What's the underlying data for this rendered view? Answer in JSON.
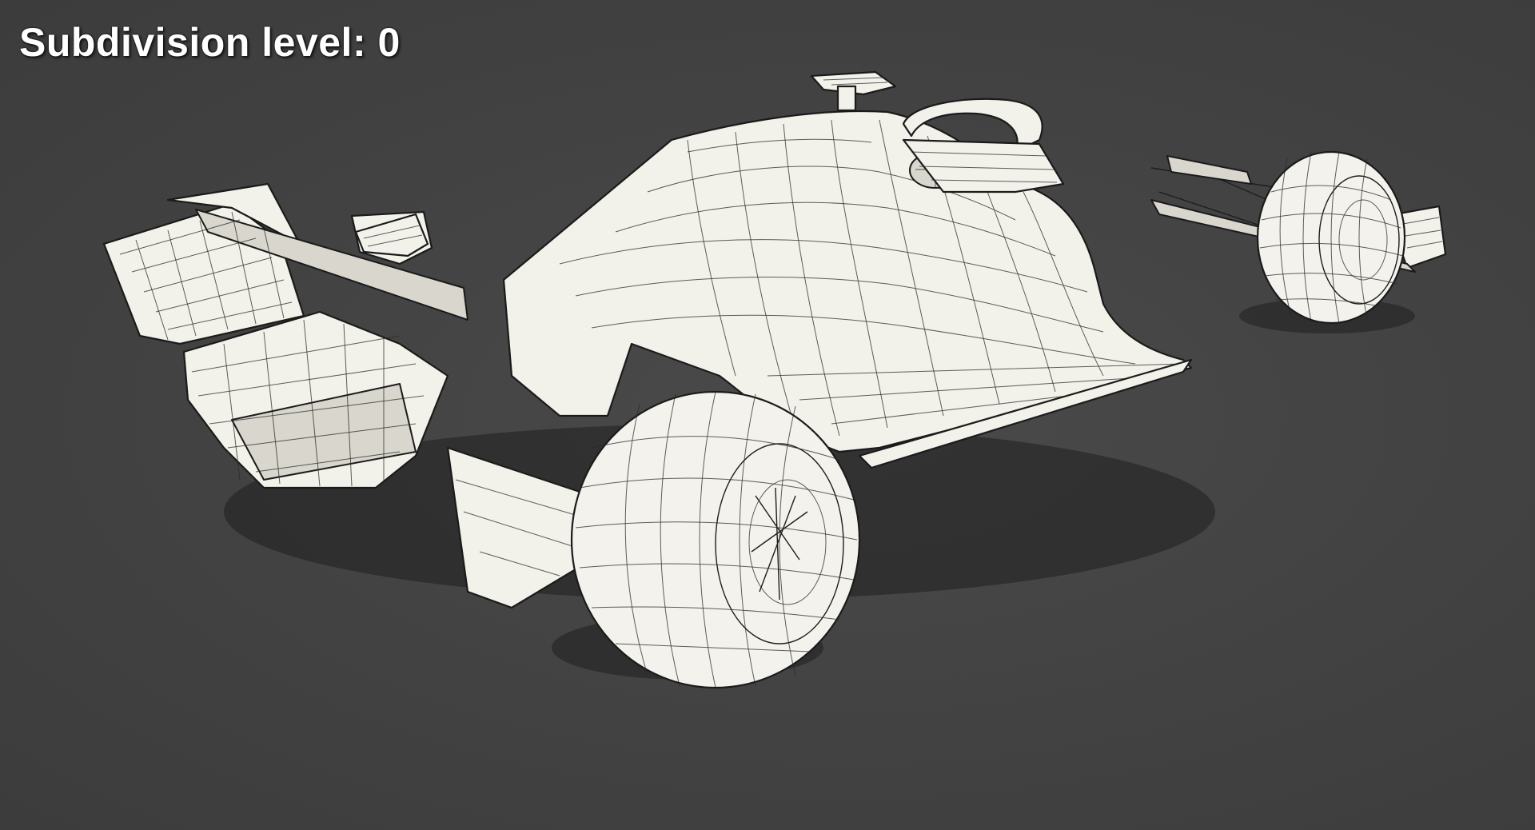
{
  "overlay": {
    "label": "Subdivision level: 0"
  },
  "scene": {
    "subject": "formula-one-car-wireframe-render",
    "background_color": "#444444",
    "mesh_color": "#f2f1ea",
    "wire_color": "#1b1b1b"
  }
}
